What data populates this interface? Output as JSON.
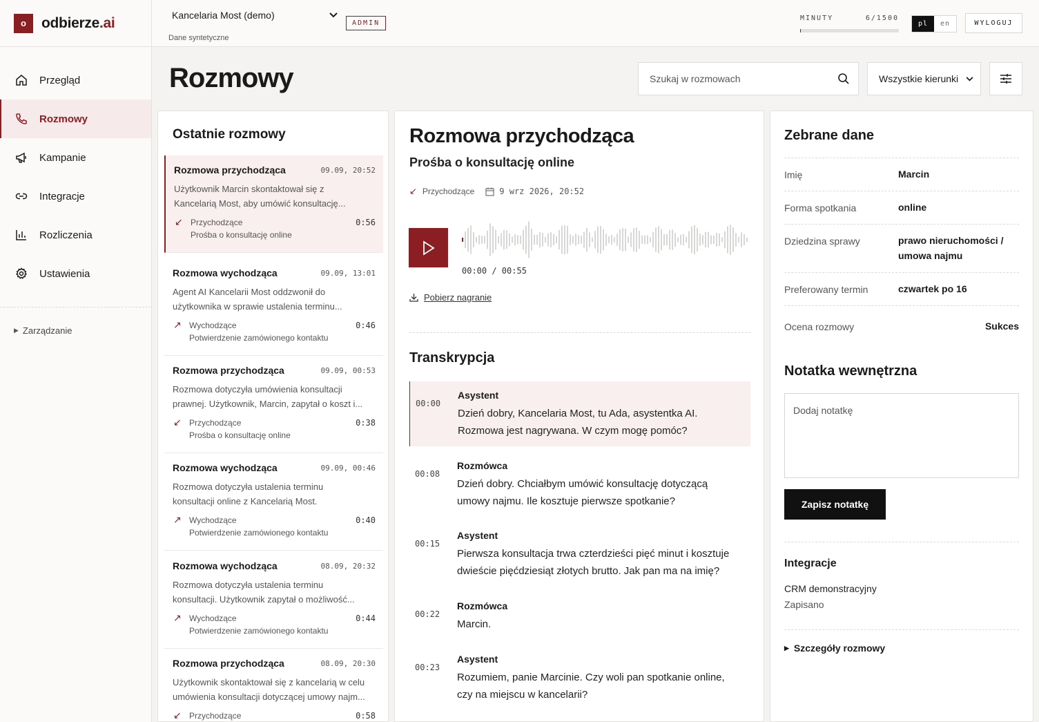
{
  "brand": {
    "mark": "o",
    "name_main": "odbierze",
    "name_accent": ".ai",
    "accent_color": "#8b1e23"
  },
  "nav": {
    "items": [
      {
        "label": "Przegląd",
        "icon": "home-icon"
      },
      {
        "label": "Rozmowy",
        "icon": "phone-icon",
        "active": true
      },
      {
        "label": "Kampanie",
        "icon": "megaphone-icon"
      },
      {
        "label": "Integracje",
        "icon": "link-icon"
      },
      {
        "label": "Rozliczenia",
        "icon": "bar-chart-icon"
      },
      {
        "label": "Ustawienia",
        "icon": "gear-icon"
      }
    ],
    "manage_label": "Zarządzanie"
  },
  "topbar": {
    "org_name": "Kancelaria Most (demo)",
    "org_sub": "Dane syntetyczne",
    "role_badge": "ADMIN",
    "minutes_label": "MINUTY",
    "minutes_value": "6/1500",
    "minutes_used_fraction": 0.004,
    "lang_active": "pl",
    "lang_other": "en",
    "logout_label": "WYLOGUJ"
  },
  "page": {
    "title": "Rozmowy",
    "search_placeholder": "Szukaj w rozmowach",
    "direction_filter": "Wszystkie kierunki"
  },
  "list": {
    "title": "Ostatnie rozmowy",
    "calls": [
      {
        "title": "Rozmowa przychodząca",
        "time": "09.09, 20:52",
        "summary": "Użytkownik Marcin skontaktował się z Kancelarią Most, aby umówić konsultację...",
        "direction": "Przychodzące",
        "duration": "0:56",
        "topic": "Prośba o konsultację online",
        "selected": true,
        "incoming": true
      },
      {
        "title": "Rozmowa wychodząca",
        "time": "09.09, 13:01",
        "summary": "Agent AI Kancelarii Most oddzwonił do użytkownika w sprawie ustalenia terminu...",
        "direction": "Wychodzące",
        "duration": "0:46",
        "topic": "Potwierdzenie zamówionego kontaktu",
        "incoming": false
      },
      {
        "title": "Rozmowa przychodząca",
        "time": "09.09, 00:53",
        "summary": "Rozmowa dotyczyła umówienia konsultacji prawnej. Użytkownik, Marcin, zapytał o koszt i...",
        "direction": "Przychodzące",
        "duration": "0:38",
        "topic": "Prośba o konsultację online",
        "incoming": true
      },
      {
        "title": "Rozmowa wychodząca",
        "time": "09.09, 00:46",
        "summary": "Rozmowa dotyczyła ustalenia terminu konsultacji online z Kancelarią Most. Użytkownik...",
        "direction": "Wychodzące",
        "duration": "0:40",
        "topic": "Potwierdzenie zamówionego kontaktu",
        "incoming": false
      },
      {
        "title": "Rozmowa wychodząca",
        "time": "08.09, 20:32",
        "summary": "Rozmowa dotyczyła ustalenia terminu konsultacji. Użytkownik zapytał o możliwość...",
        "direction": "Wychodzące",
        "duration": "0:44",
        "topic": "Potwierdzenie zamówionego kontaktu",
        "incoming": false
      },
      {
        "title": "Rozmowa przychodząca",
        "time": "08.09, 20:30",
        "summary": "Użytkownik skontaktował się z kancelarią w celu umówienia konsultacji dotyczącej umowy najm...",
        "direction": "Przychodzące",
        "duration": "0:58",
        "topic": "",
        "incoming": true
      }
    ]
  },
  "detail": {
    "title": "Rozmowa przychodząca",
    "subtitle": "Prośba o konsultację online",
    "direction": "Przychodzące",
    "date": "9 wrz 2026, 20:52",
    "player_time": "00:00 / 00:55",
    "download_label": "Pobierz nagranie",
    "transcript_title": "Transkrypcja",
    "segments": [
      {
        "time": "00:00",
        "speaker": "Asystent",
        "text": "Dzień dobry, Kancelaria Most, tu Ada, asystentka AI. Rozmowa jest nagrywana. W czym mogę pomóc?",
        "active": true
      },
      {
        "time": "00:08",
        "speaker": "Rozmówca",
        "text": "Dzień dobry. Chciałbym umówić konsultację dotyczącą umowy najmu. Ile kosztuje pierwsze spotkanie?"
      },
      {
        "time": "00:15",
        "speaker": "Asystent",
        "text": "Pierwsza konsultacja trwa czterdzieści pięć minut i kosztuje dwieście pięćdziesiąt złotych brutto. Jak pan ma na imię?"
      },
      {
        "time": "00:22",
        "speaker": "Rozmówca",
        "text": "Marcin."
      },
      {
        "time": "00:23",
        "speaker": "Asystent",
        "text": "Rozumiem, panie Marcinie. Czy woli pan spotkanie online, czy na miejscu w kancelarii?"
      }
    ]
  },
  "collected": {
    "title": "Zebrane dane",
    "fields": [
      {
        "label": "Imię",
        "value": "Marcin"
      },
      {
        "label": "Forma spotkania",
        "value": "online"
      },
      {
        "label": "Dziedzina sprawy",
        "value": "prawo nieruchomości / umowa najmu"
      },
      {
        "label": "Preferowany termin",
        "value": "czwartek po 16"
      },
      {
        "label": "Ocena rozmowy",
        "value": "Sukces"
      }
    ],
    "note_title": "Notatka wewnętrzna",
    "note_placeholder": "Dodaj notatkę",
    "note_save": "Zapisz notatkę",
    "integrations_title": "Integracje",
    "integration_name": "CRM demonstracyjny",
    "integration_status": "Zapisano",
    "details_label": "Szczegóły rozmowy"
  }
}
